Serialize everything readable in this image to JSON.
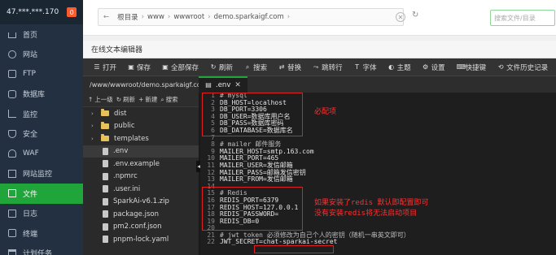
{
  "sidebar": {
    "ip": "47.***.***.170",
    "badge": "0",
    "items": [
      {
        "label": "首页",
        "icon": "home-icon"
      },
      {
        "label": "网站",
        "icon": "globe-icon"
      },
      {
        "label": "FTP",
        "icon": "ftp-icon"
      },
      {
        "label": "数据库",
        "icon": "database-icon"
      },
      {
        "label": "监控",
        "icon": "monitor-icon"
      },
      {
        "label": "安全",
        "icon": "shield-icon"
      },
      {
        "label": "WAF",
        "icon": "waf-icon"
      },
      {
        "label": "网站监控",
        "icon": "chart-icon"
      },
      {
        "label": "文件",
        "icon": "folder-icon",
        "active": true
      },
      {
        "label": "日志",
        "icon": "log-icon"
      },
      {
        "label": "终端",
        "icon": "terminal-icon"
      },
      {
        "label": "计划任务",
        "icon": "calendar-icon"
      }
    ]
  },
  "filemanager": {
    "path": [
      "根目录",
      "www",
      "wwwroot",
      "demo.sparkaigf.com"
    ],
    "search_placeholder": "搜索文件/目录"
  },
  "editor": {
    "title": "在线文本编辑器",
    "toolbar": [
      {
        "label": "打开",
        "icon": "open-icon"
      },
      {
        "label": "保存",
        "icon": "save-icon"
      },
      {
        "label": "全部保存",
        "icon": "save-all-icon"
      },
      {
        "label": "刷新",
        "icon": "refresh-icon"
      },
      {
        "label": "搜索",
        "icon": "search-icon"
      },
      {
        "label": "替换",
        "icon": "replace-icon"
      },
      {
        "label": "跳转行",
        "icon": "goto-line-icon"
      },
      {
        "label": "字体",
        "icon": "font-icon"
      },
      {
        "label": "主题",
        "icon": "theme-icon"
      },
      {
        "label": "设置",
        "icon": "gear-icon"
      },
      {
        "label": "快捷键",
        "icon": "keyboard-icon"
      },
      {
        "label": "文件历史记录",
        "icon": "history-icon"
      }
    ],
    "current_path": "/www/wwwroot/demo.sparkaigf.com",
    "tab": ".env",
    "tree_tools": [
      "上一级",
      "刷新",
      "新建",
      "搜索"
    ],
    "tree": [
      {
        "name": "dist",
        "type": "folder"
      },
      {
        "name": "public",
        "type": "folder"
      },
      {
        "name": "templates",
        "type": "folder"
      },
      {
        "name": ".env",
        "type": "file",
        "selected": true
      },
      {
        "name": ".env.example",
        "type": "file"
      },
      {
        "name": ".npmrc",
        "type": "file"
      },
      {
        "name": ".user.ini",
        "type": "file"
      },
      {
        "name": "SparkAi-v6.1.zip",
        "type": "file"
      },
      {
        "name": "package.json",
        "type": "file"
      },
      {
        "name": "pm2.conf.json",
        "type": "file"
      },
      {
        "name": "pnpm-lock.yaml",
        "type": "file"
      }
    ],
    "code": [
      {
        "n": "1",
        "t": "# mysql"
      },
      {
        "n": "2",
        "t": "DB_HOST=localhost"
      },
      {
        "n": "3",
        "t": "DB_PORT=3306"
      },
      {
        "n": "4",
        "t": "DB_USER=数据库用户名"
      },
      {
        "n": "5",
        "t": "DB_PASS=数据库密码"
      },
      {
        "n": "6",
        "t": "DB_DATABASE=数据库名"
      },
      {
        "n": "7",
        "t": ""
      },
      {
        "n": "8",
        "t": "# mailer 邮件服务"
      },
      {
        "n": "9",
        "t": "MAILER_HOST=smtp.163.com"
      },
      {
        "n": "10",
        "t": "MAILER_PORT=465"
      },
      {
        "n": "11",
        "t": "MAILER_USER=发信邮箱"
      },
      {
        "n": "12",
        "t": "MAILER_PASS=邮箱发信密钥"
      },
      {
        "n": "13",
        "t": "MAILER_FROM=发信邮箱"
      },
      {
        "n": "14",
        "t": ""
      },
      {
        "n": "15",
        "t": "# Redis"
      },
      {
        "n": "16",
        "t": "REDIS_PORT=6379"
      },
      {
        "n": "17",
        "t": "REDIS_HOST=127.0.0.1"
      },
      {
        "n": "18",
        "t": "REDIS_PASSWORD="
      },
      {
        "n": "19",
        "t": "REDIS_DB=0"
      },
      {
        "n": "20",
        "t": ""
      },
      {
        "n": "21",
        "t": "# jwt token 必须修改为自己个人的密钥（随机一串英文即可）"
      },
      {
        "n": "22",
        "t": "JWT_SECRET=chat-sparkai-secret"
      }
    ]
  },
  "annotations": {
    "mysql_note": "必配项",
    "redis_note_1": "如果安装了redis   默认即配置即可",
    "redis_note_2": "没有安装redis将无法启动项目"
  }
}
